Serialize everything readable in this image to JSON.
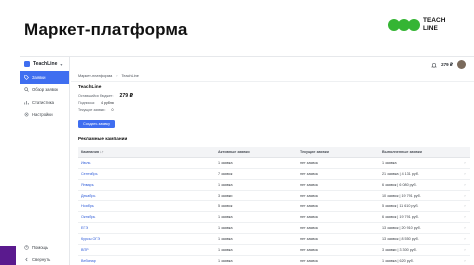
{
  "slide": {
    "title": "Маркет-платформа"
  },
  "logo": {
    "line1": "TEACH",
    "line2": "LINE"
  },
  "brand": {
    "name": "TeachLine"
  },
  "sidebar": {
    "items": [
      {
        "label": "Заявки",
        "icon": "tag-icon",
        "active": true
      },
      {
        "label": "Обзор заявок",
        "icon": "search-icon",
        "active": false
      },
      {
        "label": "Статистика",
        "icon": "chart-icon",
        "active": false
      },
      {
        "label": "Настройки",
        "icon": "gear-icon",
        "active": false
      }
    ],
    "bottom": [
      {
        "label": "Помощь",
        "icon": "help-icon"
      },
      {
        "label": "Свернуть",
        "icon": "collapse-icon"
      }
    ]
  },
  "breadcrumb": {
    "items": [
      "Маркет-платформа",
      "TeachLine"
    ]
  },
  "topbar": {
    "balance": "279 ₽"
  },
  "card": {
    "title": "TeachLine",
    "balance_label": "Оставшийся бюджет:",
    "balance_value": "279 ₽",
    "subscription_label": "Подписка:",
    "subscription_value": "4 рубля",
    "applications_label": "Текущие заявки:",
    "applications_value": "0",
    "button_label": "Создать заявку"
  },
  "section": {
    "title": "Рекламные кампании"
  },
  "table": {
    "headers": [
      "Кампания ↓↑",
      "Активные заявки",
      "Текущие заявки",
      "Выполненные заявки",
      ""
    ],
    "rows": [
      [
        "Июль",
        "1 заявка",
        "нет заявок",
        "1 заявка",
        "›"
      ],
      [
        "Сентябрь",
        "7 заявок",
        "нет заявок",
        "21 заявка | 4 131 руб.",
        "›"
      ],
      [
        "Январь",
        "1 заявка",
        "нет заявок",
        "6 заявок | 6 080 руб.",
        "›"
      ],
      [
        "Декабрь",
        "3 заявки",
        "нет заявок",
        "10 заявок | 19 791 руб.",
        "›"
      ],
      [
        "Ноябрь",
        "5 заявок",
        "нет заявок",
        "5 заявок | 11 610 руб.",
        "›"
      ],
      [
        "Октябрь",
        "1 заявка",
        "нет заявок",
        "6 заявок | 19 791 руб.",
        "›"
      ],
      [
        "ЕГЭ",
        "1 заявка",
        "нет заявок",
        "13 заявок | 20 910 руб.",
        "›"
      ],
      [
        "Курсы ОГЭ",
        "1 заявка",
        "нет заявок",
        "13 заявок | 8 550 руб.",
        "›"
      ],
      [
        "ВПР",
        "1 заявка",
        "нет заявок",
        "3 заявки | 3 300 руб.",
        "›"
      ],
      [
        "Вебинар",
        "1 заявка",
        "нет заявок",
        "1 заявка | 620 руб.",
        "›"
      ]
    ]
  },
  "colors": {
    "accent": "#3f6ef0",
    "logo_green": "#35b534",
    "corner_purple": "#5a1a8e"
  }
}
